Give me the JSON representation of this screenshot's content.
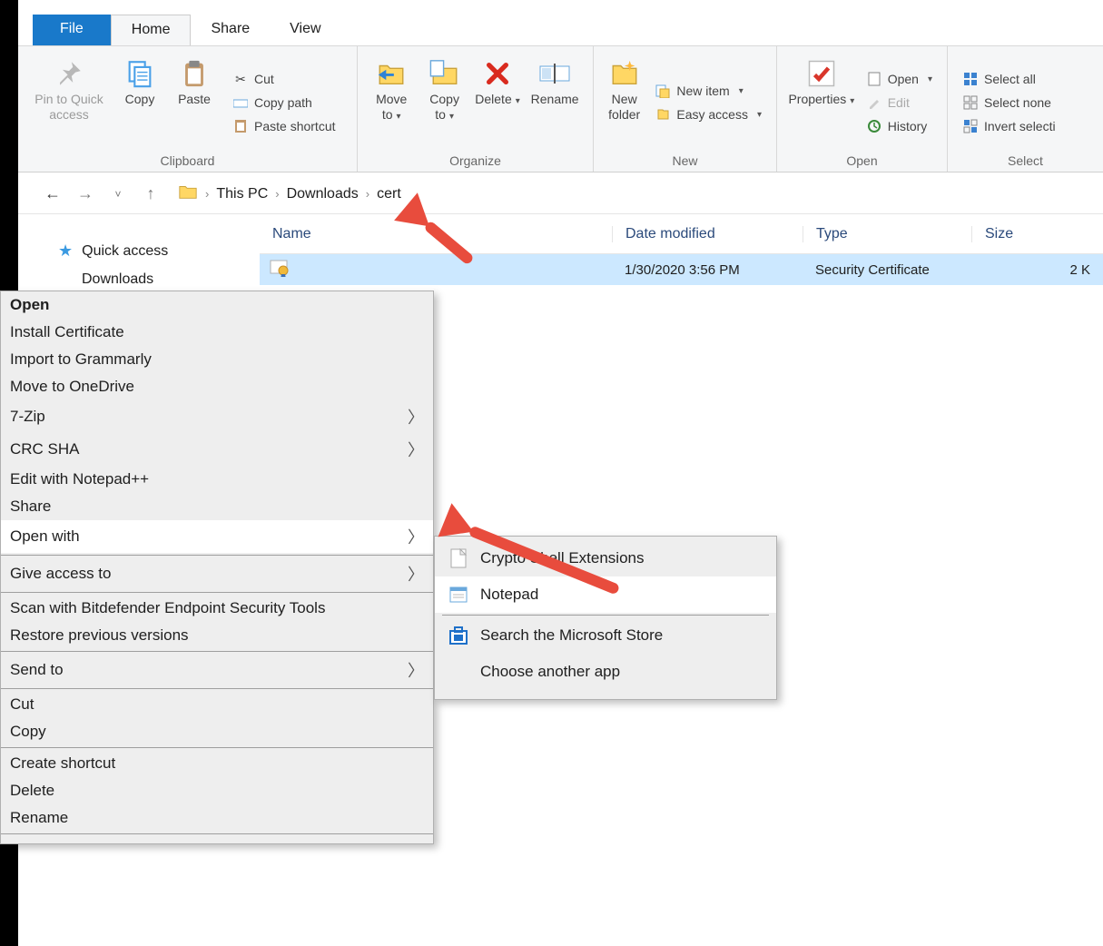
{
  "tabs": {
    "file": "File",
    "home": "Home",
    "share": "Share",
    "view": "View"
  },
  "ribbon": {
    "clipboard": {
      "label": "Clipboard",
      "pin": "Pin to Quick access",
      "copy": "Copy",
      "paste": "Paste",
      "cut": "Cut",
      "copypath": "Copy path",
      "pasteshortcut": "Paste shortcut"
    },
    "organize": {
      "label": "Organize",
      "moveto": "Move to",
      "copyto": "Copy to",
      "delete": "Delete",
      "rename": "Rename"
    },
    "new": {
      "label": "New",
      "newfolder": "New folder",
      "newitem": "New item",
      "easyaccess": "Easy access"
    },
    "open": {
      "label": "Open",
      "properties": "Properties",
      "open": "Open",
      "edit": "Edit",
      "history": "History"
    },
    "select": {
      "label": "Select",
      "selectall": "Select all",
      "selectnone": "Select none",
      "invert": "Invert selecti"
    }
  },
  "breadcrumb": {
    "a": "This PC",
    "b": "Downloads",
    "c": "cert"
  },
  "sidebar": {
    "quick": "Quick access",
    "downloads": "Downloads"
  },
  "columns": {
    "name": "Name",
    "date": "Date modified",
    "type": "Type",
    "size": "Size"
  },
  "file": {
    "name": "",
    "date": "1/30/2020 3:56 PM",
    "type": "Security Certificate",
    "size": "2 K"
  },
  "ctx": {
    "open": "Open",
    "install": "Install Certificate",
    "grammarly": "Import to Grammarly",
    "onedrive": "Move to OneDrive",
    "sevenzip": "7-Zip",
    "crcsha": "CRC SHA",
    "notepadpp": "Edit with Notepad++",
    "share": "Share",
    "openwith": "Open with",
    "giveaccess": "Give access to",
    "bitdefender": "Scan with Bitdefender Endpoint Security Tools",
    "restore": "Restore previous versions",
    "sendto": "Send to",
    "cut": "Cut",
    "copy": "Copy",
    "createshortcut": "Create shortcut",
    "delete": "Delete",
    "rename": "Rename"
  },
  "sub": {
    "crypto": "Crypto Shell Extensions",
    "notepad": "Notepad",
    "store": "Search the Microsoft Store",
    "choose": "Choose another app"
  }
}
